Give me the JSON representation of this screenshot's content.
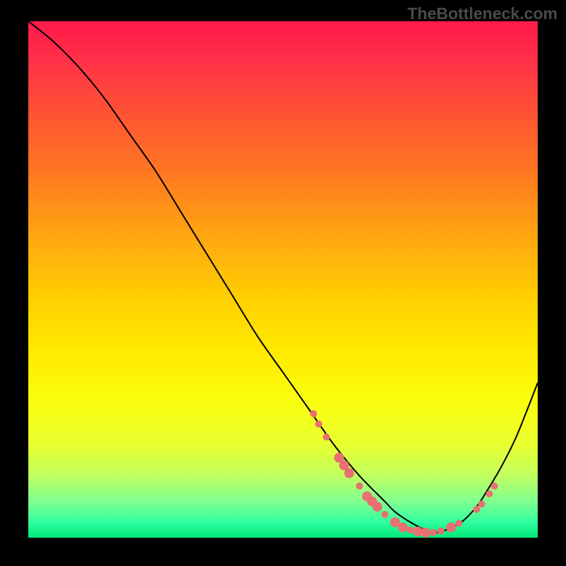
{
  "watermark": "TheBottleneck.com",
  "chart_data": {
    "type": "line",
    "title": "",
    "xlabel": "",
    "ylabel": "",
    "xlim": [
      0,
      100
    ],
    "ylim": [
      0,
      100
    ],
    "grid": false,
    "legend": false,
    "series": [
      {
        "name": "bottleneck-curve",
        "x": [
          0,
          5,
          10,
          15,
          20,
          25,
          30,
          35,
          40,
          45,
          50,
          55,
          60,
          65,
          70,
          72,
          75,
          78,
          80,
          82,
          85,
          88,
          90,
          93,
          96,
          100
        ],
        "y": [
          100,
          96,
          91,
          85,
          78,
          71,
          63,
          55,
          47,
          39,
          32,
          25,
          18,
          12,
          7,
          5,
          3,
          1.5,
          1,
          1.5,
          3,
          6,
          9,
          14,
          20,
          30
        ]
      }
    ],
    "markers": [
      {
        "x": 56,
        "y": 24,
        "r": 5
      },
      {
        "x": 57,
        "y": 22,
        "r": 5
      },
      {
        "x": 58.5,
        "y": 19.5,
        "r": 5
      },
      {
        "x": 61,
        "y": 15.5,
        "r": 7
      },
      {
        "x": 62,
        "y": 14,
        "r": 7
      },
      {
        "x": 63,
        "y": 12.5,
        "r": 7
      },
      {
        "x": 65,
        "y": 10,
        "r": 5
      },
      {
        "x": 66.5,
        "y": 8,
        "r": 7
      },
      {
        "x": 67.5,
        "y": 7,
        "r": 7
      },
      {
        "x": 68.5,
        "y": 6,
        "r": 7
      },
      {
        "x": 70,
        "y": 4.5,
        "r": 5
      },
      {
        "x": 72,
        "y": 3,
        "r": 7
      },
      {
        "x": 73.5,
        "y": 2,
        "r": 7
      },
      {
        "x": 75,
        "y": 1.5,
        "r": 5
      },
      {
        "x": 76.5,
        "y": 1.2,
        "r": 7
      },
      {
        "x": 78,
        "y": 1,
        "r": 7
      },
      {
        "x": 79.5,
        "y": 1,
        "r": 5
      },
      {
        "x": 81,
        "y": 1.3,
        "r": 5
      },
      {
        "x": 83,
        "y": 2,
        "r": 7
      },
      {
        "x": 84.5,
        "y": 2.8,
        "r": 5
      },
      {
        "x": 88,
        "y": 5.5,
        "r": 5
      },
      {
        "x": 89,
        "y": 6.5,
        "r": 5
      },
      {
        "x": 90.5,
        "y": 8.5,
        "r": 5
      },
      {
        "x": 91.5,
        "y": 10,
        "r": 5
      }
    ]
  }
}
